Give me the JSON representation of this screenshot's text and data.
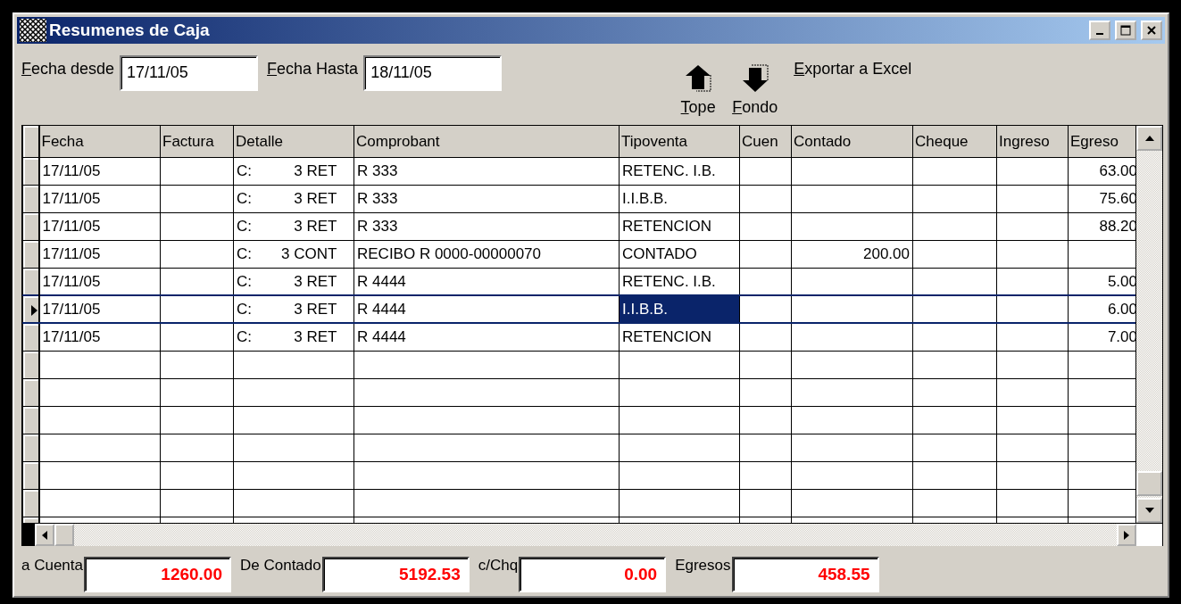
{
  "window": {
    "title": "Resumenes de Caja"
  },
  "filters": [
    {
      "label": "Fecha desde",
      "value": "17/11/05"
    },
    {
      "label": "Fecha Hasta",
      "value": "18/11/05"
    }
  ],
  "toolbar": [
    {
      "kind": "up",
      "label": "Tope"
    },
    {
      "kind": "down",
      "label": "Fondo"
    },
    {
      "kind": "link",
      "label": "Exportar a Excel"
    }
  ],
  "table": {
    "columns": [
      {
        "label": "Fecha",
        "kind": "text",
        "focused": false
      },
      {
        "label": "Factura",
        "kind": "text",
        "focused": false
      },
      {
        "label": "Detalle",
        "kind": "text",
        "focused": false
      },
      {
        "label": "Comprobant",
        "kind": "text",
        "focused": false
      },
      {
        "label": "Tipoventa",
        "kind": "text",
        "focused": true
      },
      {
        "label": "Cuen",
        "kind": "number",
        "focused": false
      },
      {
        "label": "Contado",
        "kind": "number",
        "focused": false
      },
      {
        "label": "Cheque",
        "kind": "number",
        "focused": false
      },
      {
        "label": "Ingreso",
        "kind": "number",
        "focused": false
      },
      {
        "label": "Egreso",
        "kind": "number",
        "focused": false
      }
    ],
    "rows": [
      {
        "selected": false,
        "cells": [
          "17/11/05",
          null,
          "C:          3 RET",
          "R 333",
          "RETENC. I.B.",
          null,
          null,
          null,
          null,
          "63.00"
        ]
      },
      {
        "selected": false,
        "cells": [
          "17/11/05",
          null,
          "C:          3 RET",
          "R 333",
          "I.I.B.B.",
          null,
          null,
          null,
          null,
          "75.60"
        ]
      },
      {
        "selected": false,
        "cells": [
          "17/11/05",
          null,
          "C:          3 RET",
          "R 333",
          "RETENCION",
          null,
          null,
          null,
          null,
          "88.20"
        ]
      },
      {
        "selected": false,
        "cells": [
          "17/11/05",
          null,
          "C:       3 CONT",
          "RECIBO R 0000-00000070",
          "CONTADO",
          null,
          "200.00",
          null,
          null,
          null
        ]
      },
      {
        "selected": false,
        "cells": [
          "17/11/05",
          null,
          "C:          3 RET",
          "R 4444",
          "RETENC. I.B.",
          null,
          null,
          null,
          null,
          "5.00"
        ]
      },
      {
        "selected": true,
        "cells": [
          "17/11/05",
          null,
          "C:          3 RET",
          "R 4444",
          "I.I.B.B.",
          null,
          null,
          null,
          null,
          "6.00"
        ]
      },
      {
        "selected": false,
        "cells": [
          "17/11/05",
          null,
          "C:          3 RET",
          "R 4444",
          "RETENCION",
          null,
          null,
          null,
          null,
          "7.00"
        ]
      }
    ]
  },
  "totals": [
    {
      "label": "a Cuenta",
      "value": "1260.00"
    },
    {
      "label": "De Contado",
      "value": "5192.53"
    },
    {
      "label": "c/Chq",
      "value": "0.00"
    },
    {
      "label": "Egresos",
      "value": "458.55"
    }
  ]
}
